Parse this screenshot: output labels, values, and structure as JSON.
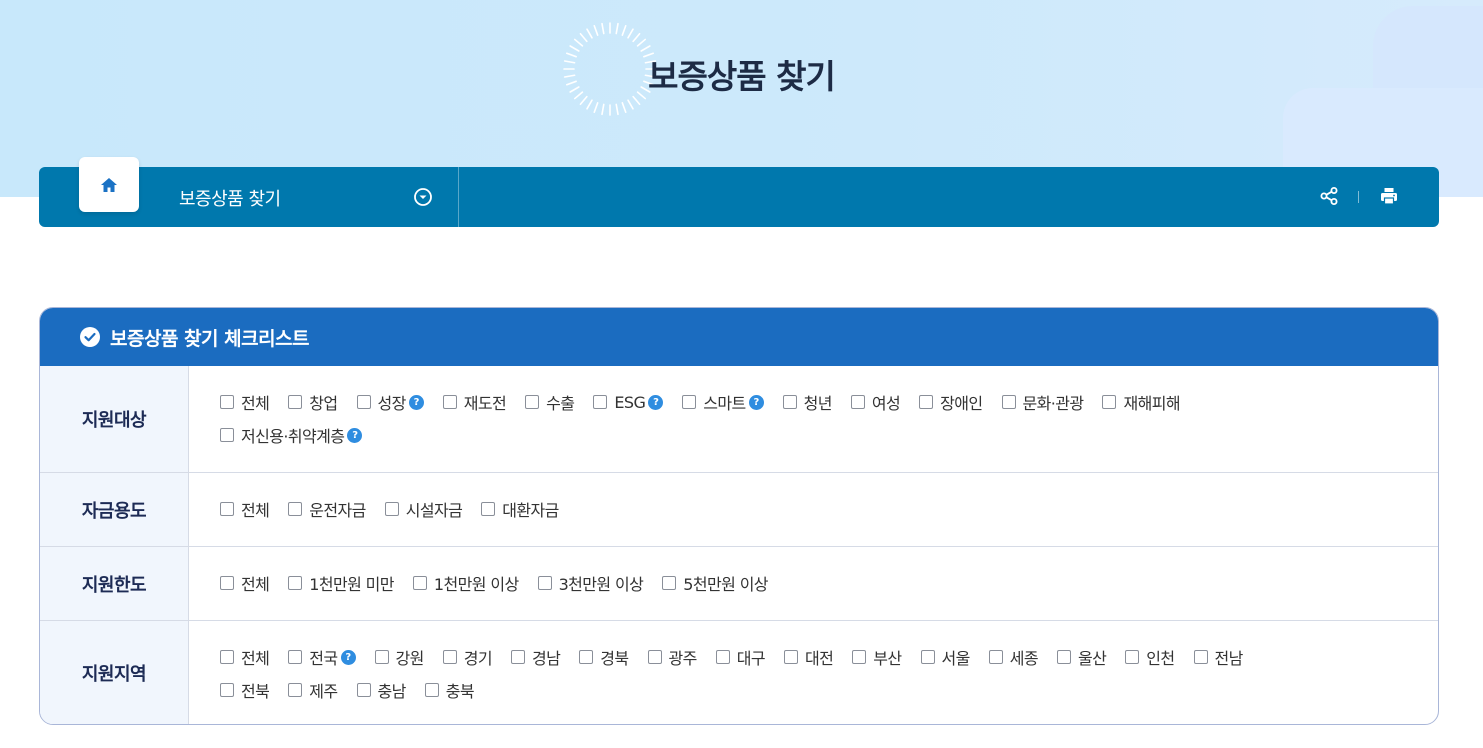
{
  "page": {
    "title": "보증상품 찾기"
  },
  "nav": {
    "current": "보증상품 찾기"
  },
  "checklist": {
    "title": "보증상품 찾기 체크리스트",
    "rows": [
      {
        "label": "지원대상",
        "lines": [
          [
            {
              "text": "전체"
            },
            {
              "text": "창업"
            },
            {
              "text": "성장",
              "help": "?"
            },
            {
              "text": "재도전"
            },
            {
              "text": "수출"
            },
            {
              "text": "ESG",
              "help": "?"
            },
            {
              "text": "스마트",
              "help": "?"
            },
            {
              "text": "청년"
            },
            {
              "text": "여성"
            },
            {
              "text": "장애인"
            },
            {
              "text": "문화·관광"
            },
            {
              "text": "재해피해"
            }
          ],
          [
            {
              "text": "저신용·취약계층",
              "help": "?"
            }
          ]
        ]
      },
      {
        "label": "자금용도",
        "lines": [
          [
            {
              "text": "전체"
            },
            {
              "text": "운전자금"
            },
            {
              "text": "시설자금"
            },
            {
              "text": "대환자금"
            }
          ]
        ]
      },
      {
        "label": "지원한도",
        "lines": [
          [
            {
              "text": "전체"
            },
            {
              "text": "1천만원 미만"
            },
            {
              "text": "1천만원 이상"
            },
            {
              "text": "3천만원 이상"
            },
            {
              "text": "5천만원 이상"
            }
          ]
        ]
      },
      {
        "label": "지원지역",
        "lines": [
          [
            {
              "text": "전체"
            },
            {
              "text": "전국",
              "help": "?"
            },
            {
              "text": "강원"
            },
            {
              "text": "경기"
            },
            {
              "text": "경남"
            },
            {
              "text": "경북"
            },
            {
              "text": "광주"
            },
            {
              "text": "대구"
            },
            {
              "text": "대전"
            },
            {
              "text": "부산"
            },
            {
              "text": "서울"
            },
            {
              "text": "세종"
            },
            {
              "text": "울산"
            },
            {
              "text": "인천"
            },
            {
              "text": "전남"
            }
          ],
          [
            {
              "text": "전북"
            },
            {
              "text": "제주"
            },
            {
              "text": "충남"
            },
            {
              "text": "충북"
            }
          ]
        ]
      }
    ]
  },
  "colors": {
    "nav": "#0078ad",
    "panel_header": "#1b6cc0",
    "hero": "#c8e8fb",
    "help_badge": "#2f8de0",
    "label_text": "#1d2b55"
  },
  "icons": {
    "home": "home-icon",
    "dropdown": "chevron-down-circle-icon",
    "share": "share-icon",
    "print": "print-icon",
    "check": "check-circle-icon",
    "help": "question-icon"
  }
}
